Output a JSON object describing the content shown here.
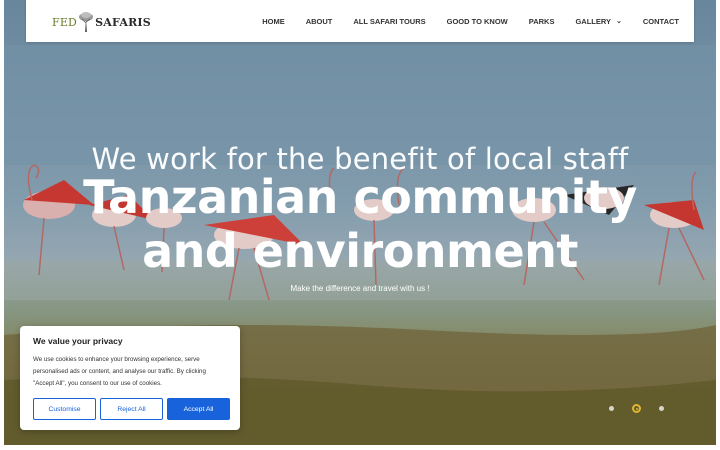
{
  "brand": {
    "left": "FED",
    "right": "SAFARIS"
  },
  "nav": [
    {
      "label": "HOME"
    },
    {
      "label": "ABOUT"
    },
    {
      "label": "ALL SAFARI TOURS"
    },
    {
      "label": "GOOD TO KNOW"
    },
    {
      "label": "PARKS"
    },
    {
      "label": "GALLERY",
      "has_dropdown": true
    },
    {
      "label": "CONTACT"
    }
  ],
  "hero": {
    "line1": "We work for the benefit of local staff",
    "line2": "Tanzanian community",
    "line3": "and environment",
    "tagline": "Make the difference and travel with us !",
    "slider": {
      "total": 3,
      "active": 2
    }
  },
  "cookie": {
    "title": "We value your privacy",
    "text": "We use cookies to enhance your browsing experience, serve personalised ads or content, and analyse our traffic. By clicking \"Accept All\", you consent to our use of cookies.",
    "customise": "Customise",
    "reject": "Reject All",
    "accept": "Accept All"
  },
  "colors": {
    "accent": "#1863dc",
    "slider_active": "#e2b52e",
    "logo_green": "#6b7d2a"
  }
}
